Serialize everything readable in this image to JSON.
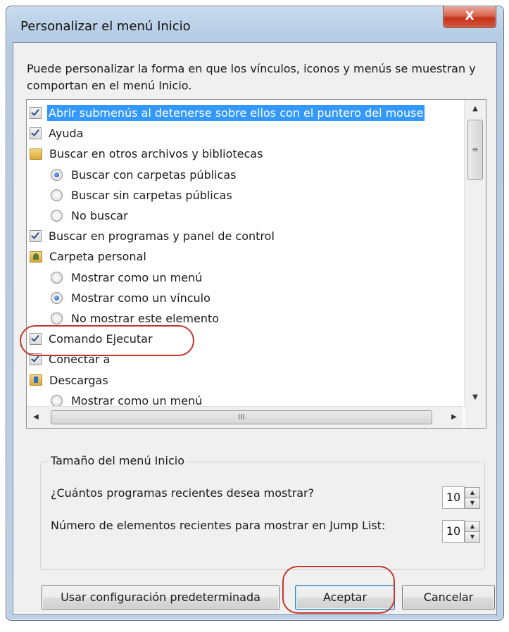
{
  "window": {
    "title": "Personalizar el menú Inicio",
    "close_label": "X"
  },
  "description": "Puede personalizar la forma en que los vínculos, iconos y menús se muestran y comportan en el menú Inicio.",
  "list": {
    "items": [
      {
        "type": "checkbox",
        "checked": true,
        "label": "Abrir submenús al detenerse sobre ellos con el puntero del mouse",
        "selected": true
      },
      {
        "type": "checkbox",
        "checked": true,
        "label": "Ayuda"
      },
      {
        "type": "folder",
        "icon": "folder-icon",
        "label": "Buscar en otros archivos y bibliotecas"
      },
      {
        "type": "radio",
        "checked": true,
        "label": "Buscar con carpetas públicas"
      },
      {
        "type": "radio",
        "checked": false,
        "label": "Buscar sin carpetas públicas"
      },
      {
        "type": "radio",
        "checked": false,
        "label": "No buscar"
      },
      {
        "type": "checkbox",
        "checked": true,
        "label": "Buscar en programas y panel de control"
      },
      {
        "type": "folder",
        "icon": "user-folder-icon",
        "label": "Carpeta personal"
      },
      {
        "type": "radio",
        "checked": false,
        "label": "Mostrar como un menú"
      },
      {
        "type": "radio",
        "checked": true,
        "label": "Mostrar como un vínculo"
      },
      {
        "type": "radio",
        "checked": false,
        "label": "No mostrar este elemento"
      },
      {
        "type": "checkbox",
        "checked": true,
        "label": "Comando Ejecutar"
      },
      {
        "type": "checkbox",
        "checked": true,
        "label": "Conectar a"
      },
      {
        "type": "folder",
        "icon": "downloads-folder-icon",
        "label": "Descargas"
      },
      {
        "type": "radio",
        "checked": false,
        "label": "Mostrar como un menú"
      }
    ],
    "scroll_up": "▲",
    "scroll_down": "▼",
    "scroll_left": "◀",
    "scroll_right": "▶",
    "thumb_grip": "≡",
    "hthumb_grip": "III"
  },
  "group": {
    "title": "Tamaño del menú Inicio",
    "recent_programs_label": "¿Cuántos programas recientes desea mostrar?",
    "recent_programs_value": "10",
    "jump_list_label": "Número de elementos recientes para mostrar en Jump List:",
    "jump_list_value": "10",
    "spin_up": "▲",
    "spin_down": "▼"
  },
  "buttons": {
    "defaults": "Usar configuración predeterminada",
    "ok": "Aceptar",
    "cancel": "Cancelar"
  },
  "annotation_color": "#c0392b"
}
